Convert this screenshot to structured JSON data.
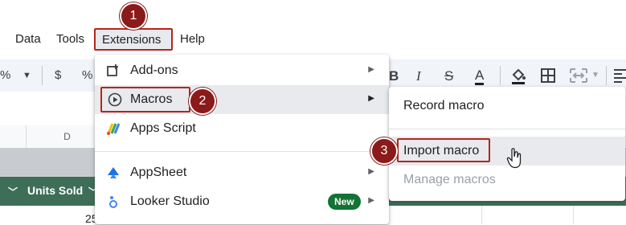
{
  "menubar": {
    "items": [
      "Data",
      "Tools",
      "Extensions",
      "Help"
    ]
  },
  "toolbar": {
    "percent": "%",
    "dollar": "$",
    "percent2": "%",
    "bold": "B",
    "italic": "I",
    "strike": "S",
    "textcolor": "A"
  },
  "columns": {
    "d": "D"
  },
  "header_row": {
    "units_sold": "Units Sold"
  },
  "data_row": {
    "partial_value": "25"
  },
  "extensions_menu": {
    "items": [
      {
        "label": "Add-ons",
        "icon": "add-ons-icon",
        "submenu": true
      },
      {
        "label": "Macros",
        "icon": "macros-play-icon",
        "submenu": true
      },
      {
        "label": "Apps Script",
        "icon": "apps-script-icon",
        "submenu": false
      },
      {
        "label": "AppSheet",
        "icon": "appsheet-icon",
        "submenu": true
      },
      {
        "label": "Looker Studio",
        "icon": "looker-studio-icon",
        "submenu": true,
        "badge": "New"
      }
    ]
  },
  "macros_submenu": {
    "items": [
      {
        "label": "Record macro",
        "enabled": true
      },
      {
        "label": "Import macro",
        "enabled": true
      },
      {
        "label": "Manage macros",
        "enabled": false
      }
    ]
  },
  "steps": [
    "1",
    "2",
    "3"
  ],
  "colors": {
    "accent_red": "#b3261e",
    "step_marker": "#8b1a1a",
    "header_green": "#3f6e58",
    "new_badge": "#137333"
  }
}
